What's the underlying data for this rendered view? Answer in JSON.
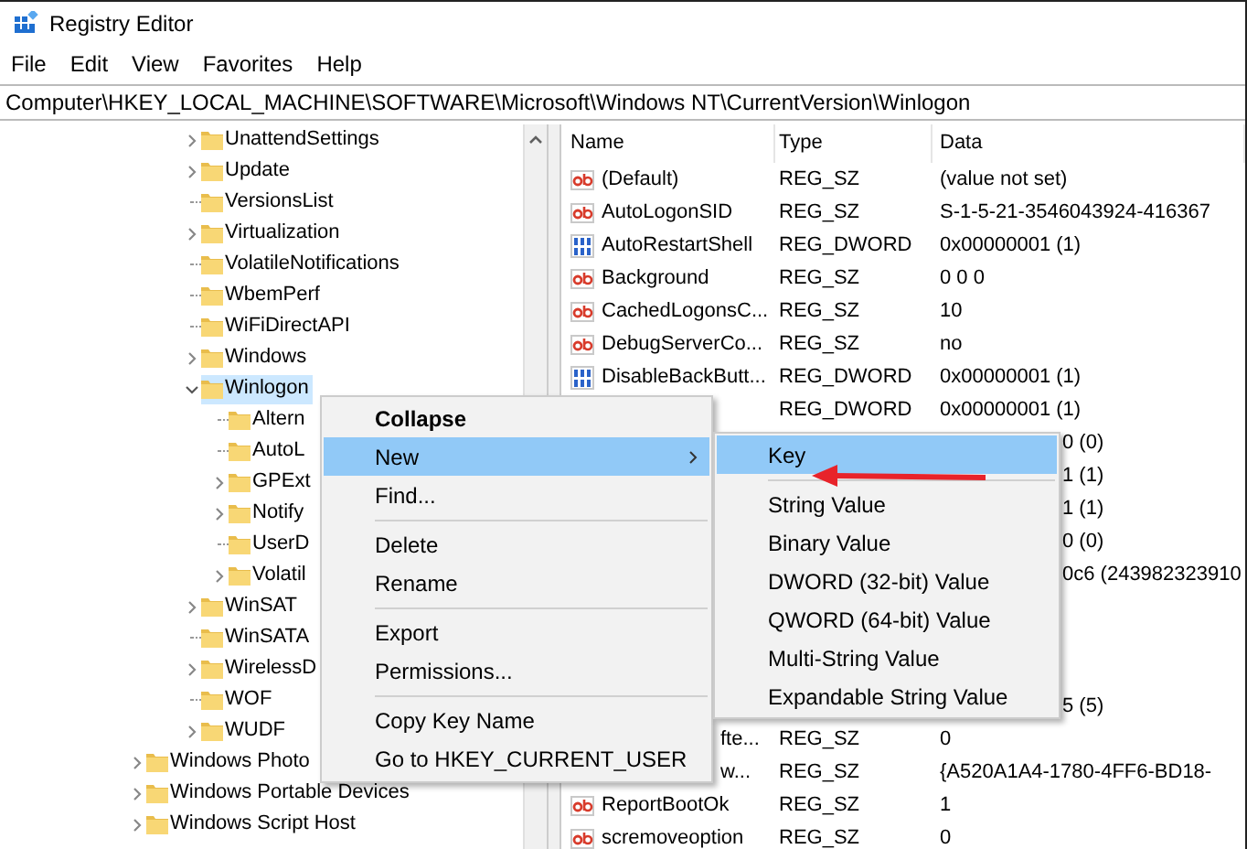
{
  "window": {
    "title": "Registry Editor"
  },
  "menu_bar": [
    "File",
    "Edit",
    "View",
    "Favorites",
    "Help"
  ],
  "address_bar": {
    "value": "Computer\\HKEY_LOCAL_MACHINE\\SOFTWARE\\Microsoft\\Windows NT\\CurrentVersion\\Winlogon"
  },
  "tree": {
    "items": [
      {
        "children": [
          {
            "children": [
              {
                "label": "UnattendSettings",
                "kind": "collapsed",
                "selected": false
              },
              {
                "label": "Update",
                "kind": "collapsed",
                "selected": false
              },
              {
                "label": "VersionsList",
                "kind": "leaf",
                "selected": false
              },
              {
                "label": "Virtualization",
                "kind": "collapsed",
                "selected": false
              },
              {
                "label": "VolatileNotifications",
                "kind": "leaf",
                "selected": false
              },
              {
                "label": "WbemPerf",
                "kind": "leaf",
                "selected": false
              },
              {
                "label": "WiFiDirectAPI",
                "kind": "leaf",
                "selected": false
              },
              {
                "label": "Windows",
                "kind": "collapsed",
                "selected": false
              },
              {
                "label": "Winlogon",
                "kind": "expanded",
                "selected": true,
                "children": [
                  {
                    "label": "Altern",
                    "kind": "leaf",
                    "selected": false
                  },
                  {
                    "label": "AutoL",
                    "kind": "leaf",
                    "selected": false
                  },
                  {
                    "label": "GPExt",
                    "kind": "collapsed",
                    "selected": false
                  },
                  {
                    "label": "Notify",
                    "kind": "collapsed",
                    "selected": false
                  },
                  {
                    "label": "UserD",
                    "kind": "leaf",
                    "selected": false
                  },
                  {
                    "label": "Volatil",
                    "kind": "collapsed",
                    "selected": false
                  }
                ]
              },
              {
                "label": "WinSAT",
                "kind": "collapsed",
                "selected": false
              },
              {
                "label": "WinSATA",
                "kind": "leaf",
                "selected": false
              },
              {
                "label": "WirelessD",
                "kind": "collapsed",
                "selected": false
              },
              {
                "label": "WOF",
                "kind": "leaf",
                "selected": false
              },
              {
                "label": "WUDF",
                "kind": "collapsed",
                "selected": false
              }
            ]
          }
        ]
      },
      {
        "label": "Windows Photo",
        "kind": "collapsed",
        "selected": false
      },
      {
        "label": "Windows Portable Devices",
        "kind": "collapsed",
        "selected": false
      },
      {
        "label": "Windows Script Host",
        "kind": "collapsed",
        "selected": false
      }
    ]
  },
  "values": {
    "columns": [
      "Name",
      "Type",
      "Data"
    ],
    "rows": [
      {
        "kind": "string",
        "name": "(Default)",
        "type": "REG_SZ",
        "data": "(value not set)"
      },
      {
        "kind": "string",
        "name": "AutoLogonSID",
        "type": "REG_SZ",
        "data": "S-1-5-21-3546043924-416367"
      },
      {
        "kind": "binary",
        "name": "AutoRestartShell",
        "type": "REG_DWORD",
        "data": "0x00000001 (1)"
      },
      {
        "kind": "string",
        "name": "Background",
        "type": "REG_SZ",
        "data": "0 0 0"
      },
      {
        "kind": "string",
        "name": "CachedLogonsC...",
        "type": "REG_SZ",
        "data": "10"
      },
      {
        "kind": "string",
        "name": "DebugServerCo...",
        "type": "REG_SZ",
        "data": "no"
      },
      {
        "kind": "binary",
        "name": "DisableBackButt...",
        "type": "REG_DWORD",
        "data": "0x00000001 (1)"
      },
      {
        "kind": "type_only",
        "type": "REG_DWORD",
        "data": "0x00000001 (1)"
      },
      {
        "kind": "submenu_edge",
        "data": "0 (0)"
      },
      {
        "kind": "submenu_edge",
        "data": "1 (1)"
      },
      {
        "kind": "submenu_edge",
        "data": "1 (1)"
      },
      {
        "kind": "submenu_edge",
        "data": "0 (0)"
      },
      {
        "kind": "submenu_edge",
        "data": "0c6 (243982323910"
      },
      {
        "kind": "covered"
      },
      {
        "kind": "covered"
      },
      {
        "kind": "covered"
      },
      {
        "kind": "submenu_edge",
        "data": "5 (5)"
      },
      {
        "kind": "menu_edge",
        "name": "fte...",
        "type": "REG_SZ",
        "data": "0"
      },
      {
        "kind": "menu_edge",
        "name": "w...",
        "type": "REG_SZ",
        "data": "{A520A1A4-1780-4FF6-BD18-"
      },
      {
        "kind": "string",
        "name": "ReportBootOk",
        "type": "REG_SZ",
        "data": "1"
      },
      {
        "kind": "string",
        "name": "scremoveoption",
        "type": "REG_SZ",
        "data": "0"
      }
    ]
  },
  "context_menu": {
    "items": [
      {
        "kind": "item",
        "label": "Collapse",
        "bold": true,
        "selected": false,
        "submenu": false
      },
      {
        "kind": "item",
        "label": "New",
        "bold": false,
        "selected": true,
        "submenu": true
      },
      {
        "kind": "item",
        "label": "Find...",
        "bold": false,
        "selected": false,
        "submenu": false
      },
      {
        "kind": "separator"
      },
      {
        "kind": "item",
        "label": "Delete",
        "bold": false,
        "selected": false,
        "submenu": false
      },
      {
        "kind": "item",
        "label": "Rename",
        "bold": false,
        "selected": false,
        "submenu": false
      },
      {
        "kind": "separator"
      },
      {
        "kind": "item",
        "label": "Export",
        "bold": false,
        "selected": false,
        "submenu": false
      },
      {
        "kind": "item",
        "label": "Permissions...",
        "bold": false,
        "selected": false,
        "submenu": false
      },
      {
        "kind": "separator"
      },
      {
        "kind": "item",
        "label": "Copy Key Name",
        "bold": false,
        "selected": false,
        "submenu": false
      },
      {
        "kind": "item",
        "label": "Go to HKEY_CURRENT_USER",
        "bold": false,
        "selected": false,
        "submenu": false
      }
    ]
  },
  "submenu": {
    "items": [
      {
        "kind": "item",
        "label": "Key",
        "selected": true
      },
      {
        "kind": "separator"
      },
      {
        "kind": "item",
        "label": "String Value",
        "selected": false
      },
      {
        "kind": "item",
        "label": "Binary Value",
        "selected": false
      },
      {
        "kind": "item",
        "label": "DWORD (32-bit) Value",
        "selected": false
      },
      {
        "kind": "item",
        "label": "QWORD (64-bit) Value",
        "selected": false
      },
      {
        "kind": "item",
        "label": "Multi-String Value",
        "selected": false
      },
      {
        "kind": "item",
        "label": "Expandable String Value",
        "selected": false
      }
    ]
  }
}
